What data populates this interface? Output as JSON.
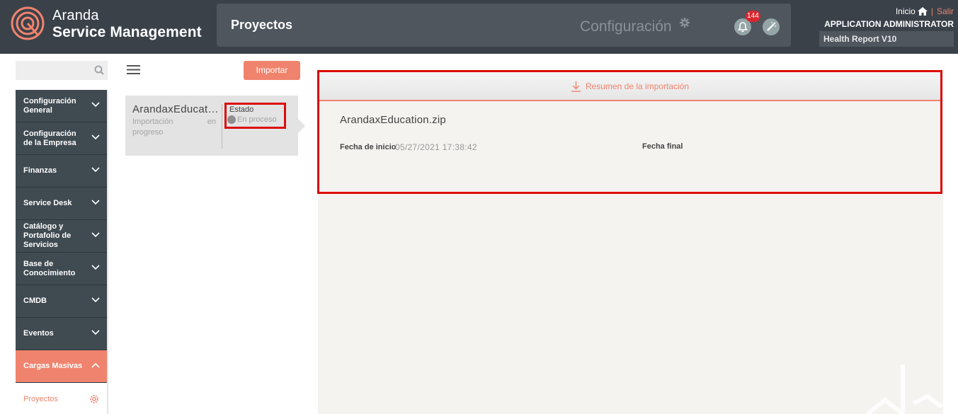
{
  "header": {
    "brand_line1": "Aranda",
    "brand_line2": "Service Management",
    "title": "Proyectos",
    "config_label": "Configuración",
    "notifications_count": "144",
    "links": {
      "home": "Inicio",
      "separator": "|",
      "logout": "Salir"
    },
    "user_name": "APPLICATION ADMINISTRATOR",
    "report_label": "Health Report V10"
  },
  "colors": {
    "header_bg": "#3a4149",
    "accent": "#f0836d",
    "highlight": "#dd0b0b",
    "sidebar_item": "#3f4a51"
  },
  "sidebar": {
    "items": [
      {
        "label": "Configuración General"
      },
      {
        "label": "Configuración de la Empresa"
      },
      {
        "label": "Finanzas"
      },
      {
        "label": "Service Desk"
      },
      {
        "label": "Catálogo y Portafolio de Servicios"
      },
      {
        "label": "Base de Conocimiento"
      },
      {
        "label": "CMDB"
      },
      {
        "label": "Eventos"
      },
      {
        "label": "Cargas Masivas"
      }
    ],
    "sub_item": "Proyectos"
  },
  "toolbar": {
    "import_label": "Importar"
  },
  "project": {
    "name": "ArandaxEducation",
    "subtitle": "Importación en progreso",
    "state_label": "Estado",
    "state_value": "En proceso"
  },
  "summary": {
    "header": "Resumen de la importación",
    "file": "ArandaxEducation.zip",
    "start_label": "Fecha de inicio",
    "start_value": "05/27/2021 17:38:42",
    "end_label": "Fecha final"
  }
}
